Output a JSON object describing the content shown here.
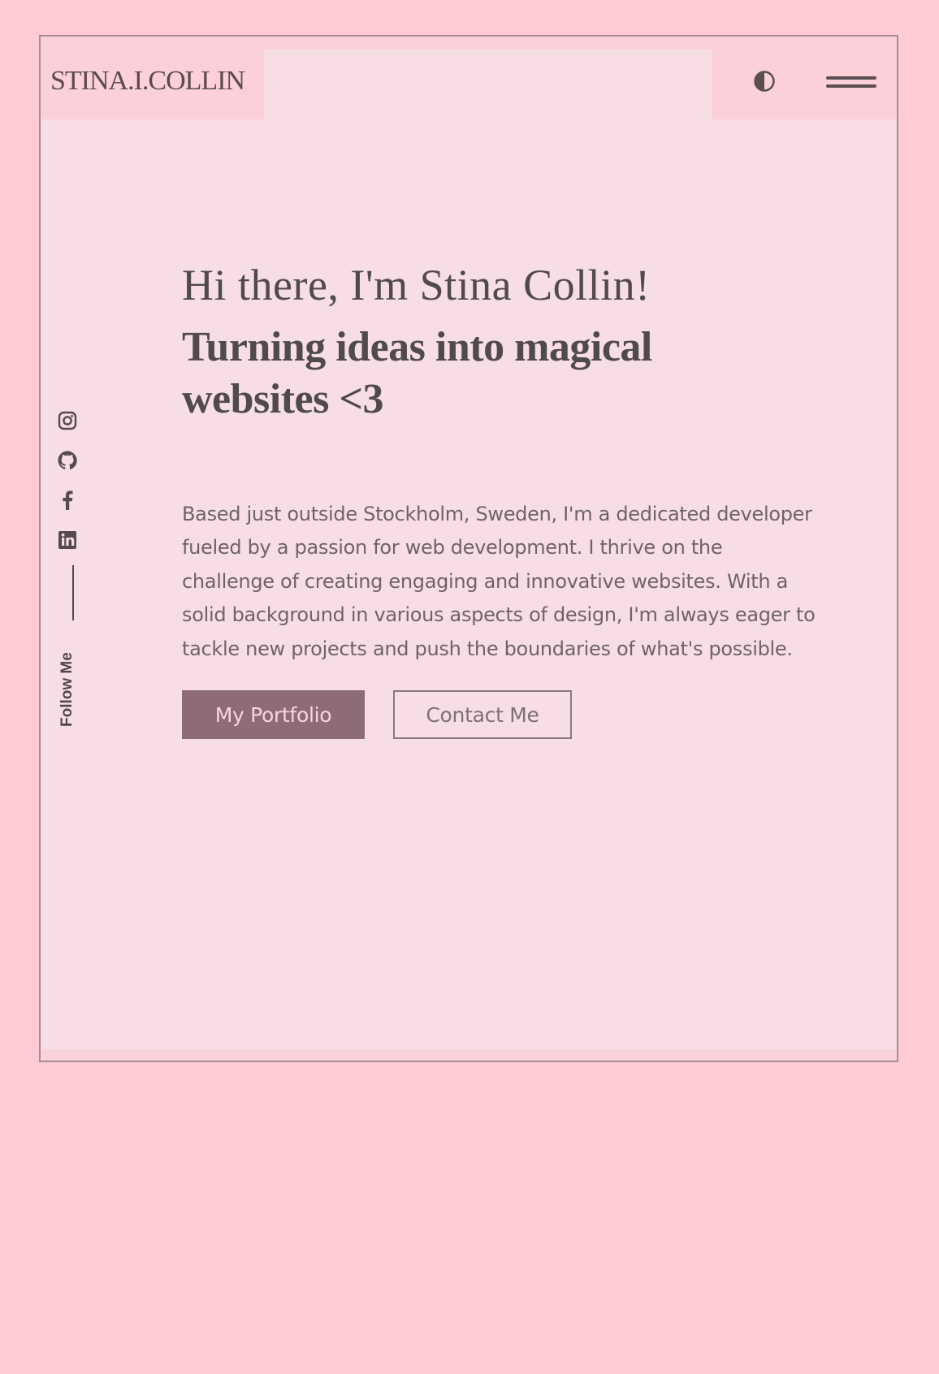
{
  "header": {
    "logo": "STINA.I.COLLIN",
    "theme_toggle_icon": "contrast-icon",
    "menu_icon": "hamburger-menu-icon"
  },
  "social": {
    "items": [
      {
        "name": "Instagram",
        "icon": "instagram-icon"
      },
      {
        "name": "GitHub",
        "icon": "github-icon"
      },
      {
        "name": "Facebook",
        "icon": "facebook-icon"
      },
      {
        "name": "LinkedIn",
        "icon": "linkedin-icon"
      }
    ],
    "label": "Follow Me"
  },
  "hero": {
    "greeting": "Hi there, I'm Stina Collin!",
    "tagline": "Turning ideas into magical websites <3",
    "bio": "Based just outside Stockholm, Sweden, I'm a dedicated developer fueled by a passion for web development. I thrive on the challenge of creating engaging and innovative websites. With a solid background in various aspects of design, I'm always eager to tackle new projects and push the boundaries of what's possible.",
    "primary_button": "My Portfolio",
    "secondary_button": "Contact Me"
  },
  "colors": {
    "page_background": "#fecad3",
    "panel_background": "#f6dee4",
    "header_background": "#fbd0d8",
    "text": "#514a4d",
    "primary_button": "#8e6b79",
    "primary_button_text": "#fbd4dc"
  }
}
